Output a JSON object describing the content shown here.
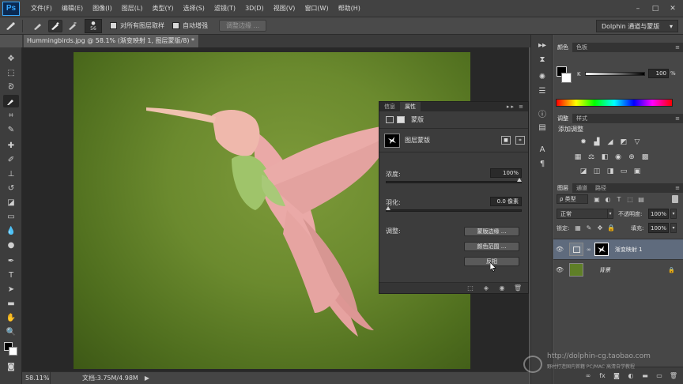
{
  "app": {
    "logo": "Ps"
  },
  "menubar": {
    "items": [
      "文件(F)",
      "编辑(E)",
      "图像(I)",
      "图层(L)",
      "类型(Y)",
      "选择(S)",
      "滤镜(T)",
      "3D(D)",
      "视图(V)",
      "窗口(W)",
      "帮助(H)"
    ],
    "minimize": "–",
    "maximize": "□",
    "close": "✕"
  },
  "options": {
    "brush_size": "56",
    "sample_all_label": "对所有图层取样",
    "auto_enhance_label": "自动增强",
    "refine_edge_label": "调整边缘 ...",
    "workspace": "Dolphin 通道与蒙版",
    "workspace_arrow": "▾"
  },
  "document": {
    "tab_title": "Hummingbirds.jpg @ 58.1% (渐变映射 1, 图层蒙版/8) *",
    "tab_close": "×",
    "zoom": "58.11%",
    "info": "文档:3.75M/4.98M",
    "info_arrow": "▶"
  },
  "properties": {
    "tabs": [
      "信息",
      "属性"
    ],
    "active_tab": "属性",
    "controls": "▸▸ ≡",
    "title": "蒙版",
    "mask_label": "图层蒙版",
    "density_label": "浓度:",
    "density_value": "100%",
    "density": 1.0,
    "feather_label": "羽化:",
    "feather_value": "0.0 像素",
    "feather": 0.0,
    "adjust_label": "调整:",
    "buttons": {
      "refine_mask": "蒙版边缘 ...",
      "color_range": "颜色范围 ...",
      "invert": "反相"
    }
  },
  "color_panel": {
    "tabs": [
      "颜色",
      "色板"
    ],
    "channel_label": "K",
    "channel_value": "100",
    "channel_unit": "%",
    "k": 1.0
  },
  "adjustments_panel": {
    "tabs": [
      "调整",
      "样式"
    ],
    "title": "添加调整"
  },
  "layers_panel": {
    "tabs": [
      "图层",
      "通道",
      "路径"
    ],
    "filter_label": "ρ 类型",
    "blend_mode": "正常",
    "opacity_label": "不透明度:",
    "opacity_value": "100%",
    "lock_label": "锁定:",
    "fill_label": "填充:",
    "fill_value": "100%",
    "layers": [
      {
        "name": "渐变映射 1",
        "selected": true
      },
      {
        "name": "背景",
        "selected": false
      }
    ]
  },
  "watermark": {
    "url": "http://dolphin-cg.taobao.com",
    "subtitle": "野村打造国内首籍 PC/MAC 高清自学教程"
  },
  "colors": {
    "accent_selected_layer": "#5f6b7d",
    "bird_pink": "#e8a6a4",
    "bird_green": "#9dc26a",
    "background_green": "#6b8a2e"
  },
  "icons": {
    "eye": "👁",
    "lock": "🔒",
    "menu": "≡"
  }
}
